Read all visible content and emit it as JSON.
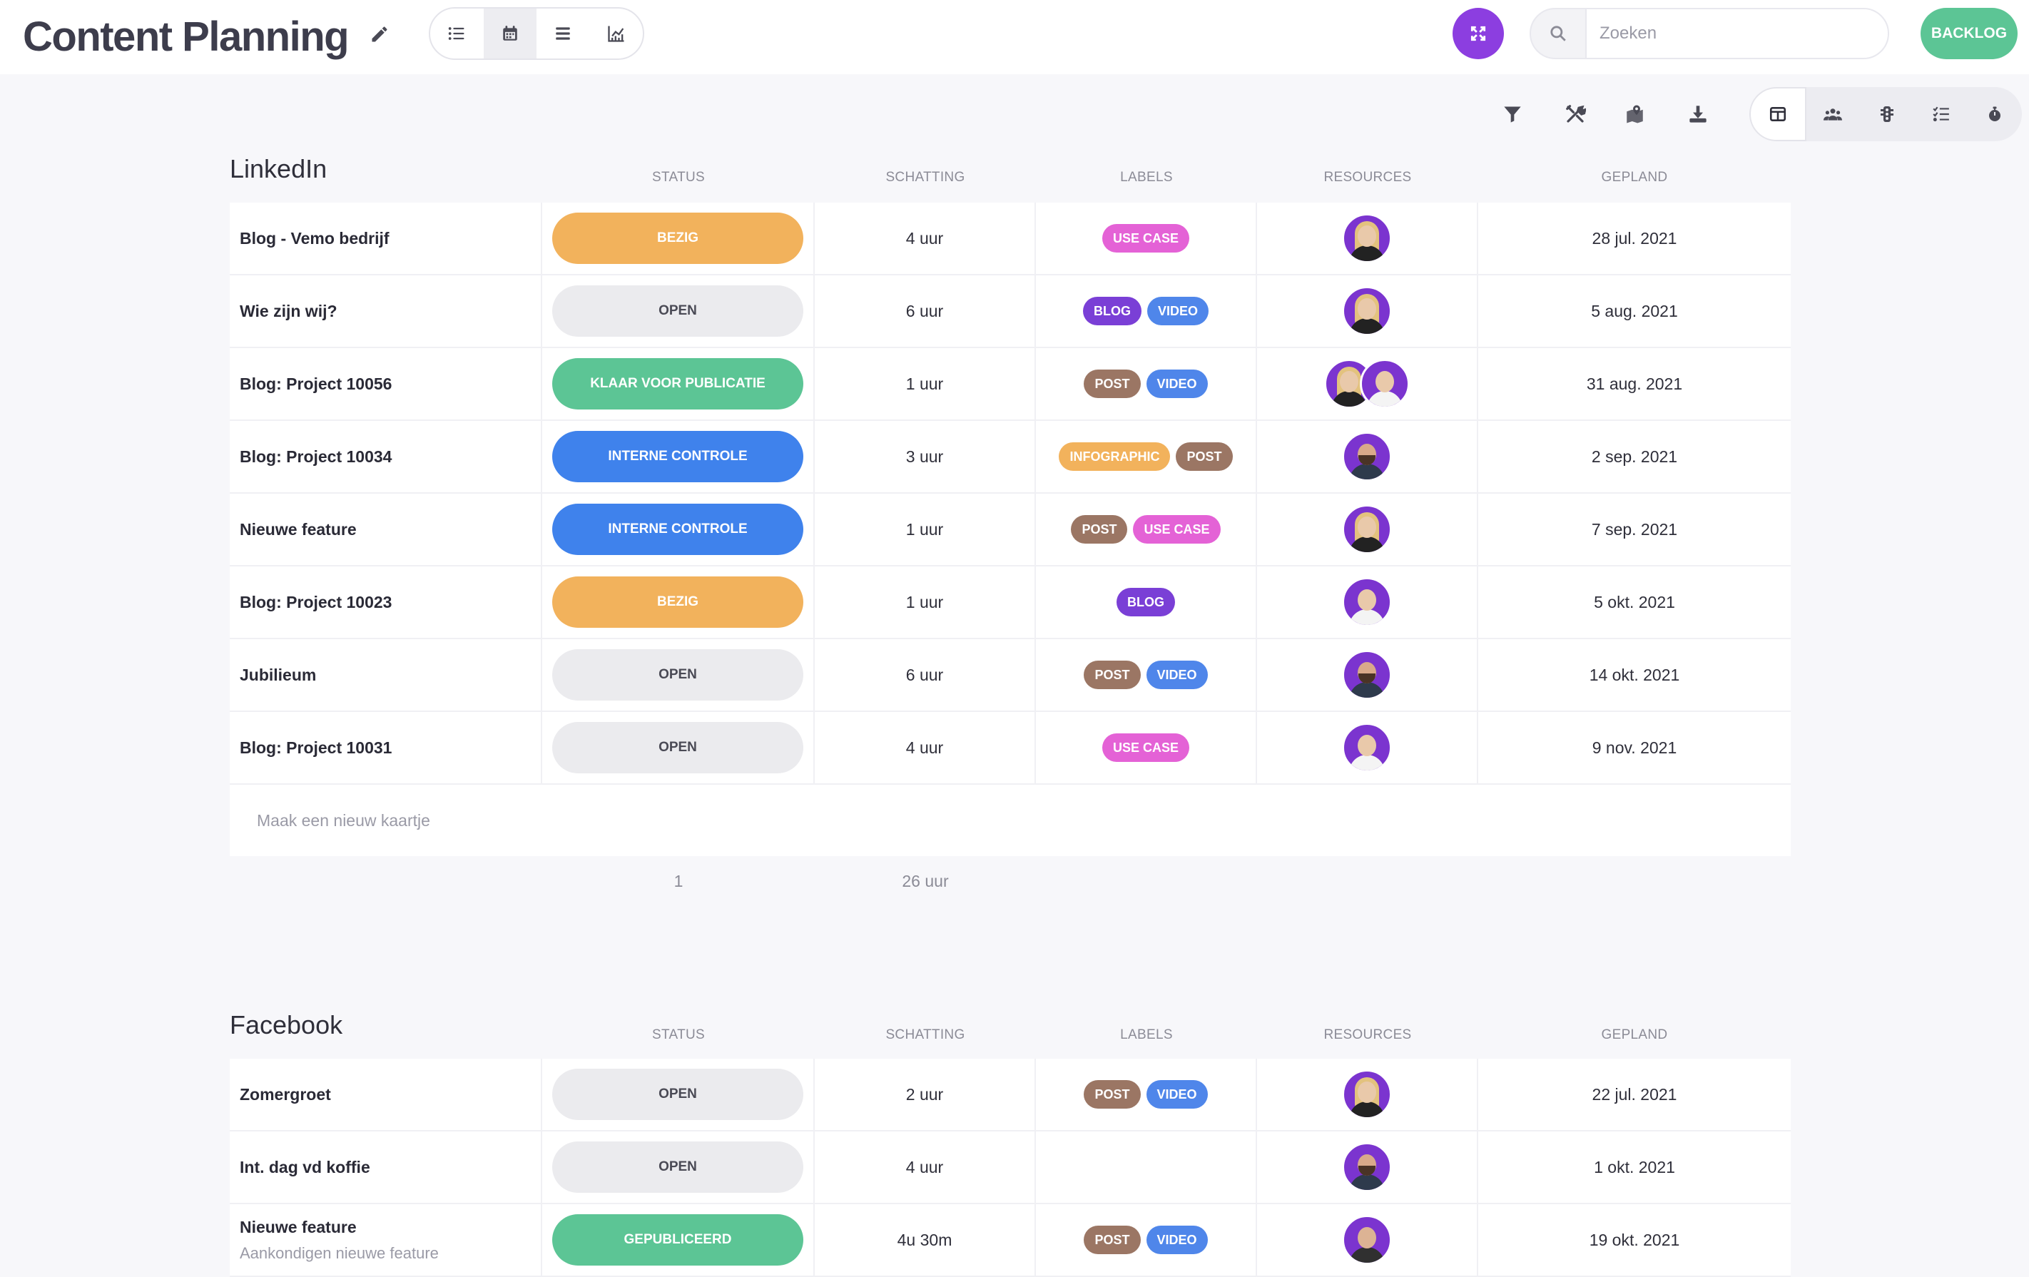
{
  "header": {
    "title": "Content Planning",
    "search_placeholder": "Zoeken",
    "backlog_label": "BACKLOG"
  },
  "colors": {
    "accent": "#8c3ee0",
    "green": "#5cc595",
    "bezig": "#f2b25c",
    "klaar": "#5cc595",
    "interne": "#3f82ec",
    "gepubliceerd": "#5cc595",
    "open": "#ebebee"
  },
  "icons": {
    "view_modes": [
      "list-icon",
      "calendar-icon",
      "rows-icon",
      "chart-icon"
    ],
    "tools": [
      "filter-icon",
      "tools-icon",
      "map-icon",
      "download-icon"
    ],
    "layouts": [
      "table-layout-icon",
      "team-icon",
      "traffic-light-icon",
      "checklist-icon",
      "stopwatch-icon"
    ]
  },
  "columns": {
    "status": "STATUS",
    "estimate": "SCHATTING",
    "labels": "LABELS",
    "resources": "RESOURCES",
    "planned": "GEPLAND"
  },
  "linkedin": {
    "title": "LinkedIn",
    "rows": [
      {
        "name": "Blog - Vemo bedrijf",
        "status": "BEZIG",
        "estimate": "4 uur",
        "labels": [
          "USE CASE"
        ],
        "resources": [
          "woman"
        ],
        "date": "28 jul. 2021"
      },
      {
        "name": "Wie zijn wij?",
        "status": "OPEN",
        "estimate": "6 uur",
        "labels": [
          "BLOG",
          "VIDEO"
        ],
        "resources": [
          "woman"
        ],
        "date": "5 aug. 2021"
      },
      {
        "name": "Blog: Project 10056",
        "status": "KLAAR VOOR PUBLICATIE",
        "estimate": "1 uur",
        "labels": [
          "POST",
          "VIDEO"
        ],
        "resources": [
          "woman",
          "man-white"
        ],
        "date": "31 aug. 2021"
      },
      {
        "name": "Blog: Project 10034",
        "status": "INTERNE CONTROLE",
        "estimate": "3 uur",
        "labels": [
          "INFOGRAPHIC",
          "POST"
        ],
        "resources": [
          "man-dark"
        ],
        "date": "2 sep. 2021"
      },
      {
        "name": "Nieuwe feature",
        "status": "INTERNE CONTROLE",
        "estimate": "1 uur",
        "labels": [
          "POST",
          "USE CASE"
        ],
        "resources": [
          "woman"
        ],
        "date": "7 sep. 2021"
      },
      {
        "name": "Blog: Project 10023",
        "status": "BEZIG",
        "estimate": "1 uur",
        "labels": [
          "BLOG"
        ],
        "resources": [
          "man-white"
        ],
        "date": "5 okt. 2021"
      },
      {
        "name": "Jubilieum",
        "status": "OPEN",
        "estimate": "6 uur",
        "labels": [
          "POST",
          "VIDEO"
        ],
        "resources": [
          "man-dark"
        ],
        "date": "14 okt. 2021"
      },
      {
        "name": "Blog: Project 10031",
        "status": "OPEN",
        "estimate": "4 uur",
        "labels": [
          "USE CASE"
        ],
        "resources": [
          "man-white"
        ],
        "date": "9 nov. 2021"
      }
    ],
    "new_card": "Maak een nieuw kaartje",
    "footer_count": "1",
    "footer_total": "26 uur"
  },
  "facebook": {
    "title": "Facebook",
    "rows": [
      {
        "name": "Zomergroet",
        "status": "OPEN",
        "estimate": "2 uur",
        "labels": [
          "POST",
          "VIDEO"
        ],
        "resources": [
          "woman"
        ],
        "date": "22 jul. 2021"
      },
      {
        "name": "Int. dag vd koffie",
        "status": "OPEN",
        "estimate": "4 uur",
        "labels": [],
        "resources": [
          "man-dark"
        ],
        "date": "1 okt. 2021"
      },
      {
        "name": "Nieuwe feature",
        "subtitle": "Aankondigen nieuwe feature",
        "status": "GEPUBLICEERD",
        "estimate": "4u 30m",
        "labels": [
          "POST",
          "VIDEO"
        ],
        "resources": [
          "man-bald"
        ],
        "date": "19 okt. 2021"
      }
    ]
  },
  "label_colors": {
    "USE CASE": "#e462d6",
    "BLOG": "#7a3fd6",
    "VIDEO": "#4f86ea",
    "POST": "#9b7664",
    "INFOGRAPHIC": "#f2b25c"
  },
  "status_colors": {
    "BEZIG": "#f2b25c",
    "OPEN": "#ebebee",
    "KLAAR VOOR PUBLICATIE": "#5cc595",
    "INTERNE CONTROLE": "#3f82ec",
    "GEPUBLICEERD": "#5cc595"
  }
}
